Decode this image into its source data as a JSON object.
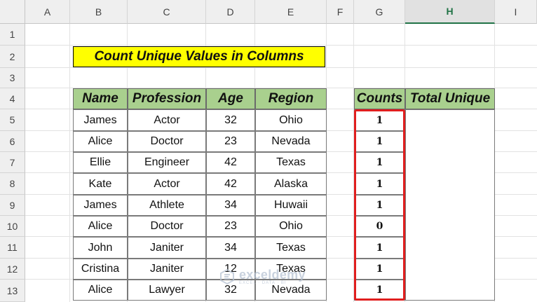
{
  "columns": [
    "A",
    "B",
    "C",
    "D",
    "E",
    "F",
    "G",
    "H",
    "I"
  ],
  "selected_column": "H",
  "rows": [
    "1",
    "2",
    "3",
    "4",
    "5",
    "6",
    "7",
    "8",
    "9",
    "10",
    "11",
    "12",
    "13"
  ],
  "title": "Count Unique Values in Columns",
  "table": {
    "headers": [
      "Name",
      "Profession",
      "Age",
      "Region"
    ],
    "rows": [
      [
        "James",
        "Actor",
        "32",
        "Ohio"
      ],
      [
        "Alice",
        "Doctor",
        "23",
        "Nevada"
      ],
      [
        "Ellie",
        "Engineer",
        "42",
        "Texas"
      ],
      [
        "Kate",
        "Actor",
        "42",
        "Alaska"
      ],
      [
        "James",
        "Athlete",
        "34",
        "Huwaii"
      ],
      [
        "Alice",
        "Doctor",
        "23",
        "Ohio"
      ],
      [
        "John",
        "Janiter",
        "34",
        "Texas"
      ],
      [
        "Cristina",
        "Janiter",
        "12",
        "Texas"
      ],
      [
        "Alice",
        "Lawyer",
        "32",
        "Nevada"
      ]
    ]
  },
  "counts_table": {
    "headers": [
      "Counts",
      "Total Unique"
    ],
    "values": [
      "1",
      "1",
      "1",
      "1",
      "1",
      "0",
      "1",
      "1",
      "1"
    ],
    "total_unique": ""
  },
  "highlight_color": "#e01e1e",
  "header_fill": "#a9d08e",
  "title_fill": "#ffff00",
  "watermark": {
    "name": "exceldemy",
    "sub": "EXCEL · DATA · BI"
  }
}
